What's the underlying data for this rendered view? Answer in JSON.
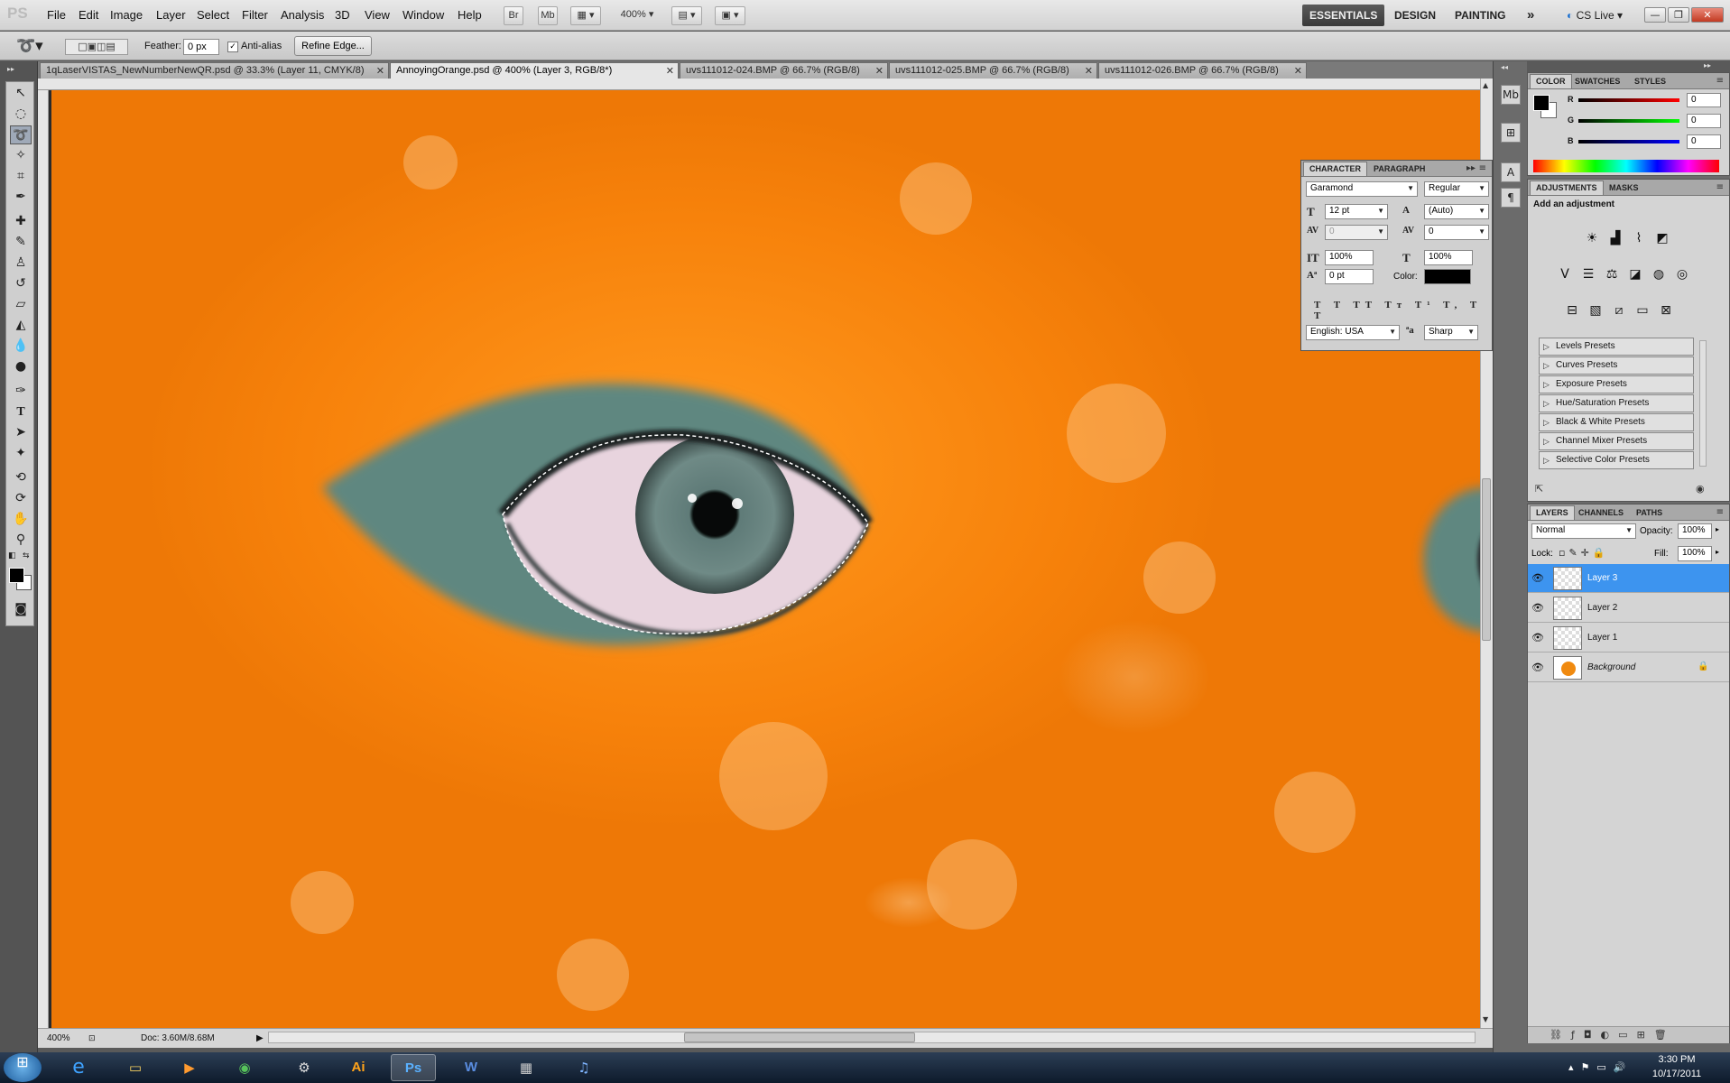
{
  "app": {
    "logo": "PS"
  },
  "menu": [
    "File",
    "Edit",
    "Image",
    "Layer",
    "Select",
    "Filter",
    "Analysis",
    "3D",
    "View",
    "Window",
    "Help"
  ],
  "menubar_buttons": {
    "bridge": "Br",
    "minibridge": "Mb",
    "zoom": "400%"
  },
  "workspaces": {
    "essentials": "ESSENTIALS",
    "design": "DESIGN",
    "painting": "PAINTING",
    "more": "»",
    "cslive": "CS Live"
  },
  "options": {
    "feather_label": "Feather:",
    "feather_value": "0 px",
    "antialias_label": "Anti-alias",
    "antialias_checked": true,
    "refine_edge": "Refine Edge..."
  },
  "tabs": [
    {
      "label": "1qLaserVISTAS_NewNumberNewQR.psd @ 33.3% (Layer 11, CMYK/8)",
      "active": false
    },
    {
      "label": "AnnoyingOrange.psd @ 400% (Layer 3, RGB/8*)",
      "active": true
    },
    {
      "label": "uvs111012-024.BMP @ 66.7% (RGB/8)",
      "active": false
    },
    {
      "label": "uvs111012-025.BMP @ 66.7% (RGB/8)",
      "active": false
    },
    {
      "label": "uvs111012-026.BMP @ 66.7% (RGB/8)",
      "active": false
    }
  ],
  "status": {
    "zoom": "400%",
    "doc": "Doc: 3.60M/8.68M"
  },
  "color_panel": {
    "tabs": [
      "COLOR",
      "SWATCHES",
      "STYLES"
    ],
    "channels": [
      {
        "name": "R",
        "value": "0"
      },
      {
        "name": "G",
        "value": "0"
      },
      {
        "name": "B",
        "value": "0"
      }
    ]
  },
  "character": {
    "tabs": [
      "CHARACTER",
      "PARAGRAPH"
    ],
    "font": "Garamond",
    "style": "Regular",
    "size": "12 pt",
    "leading": "(Auto)",
    "kerning": "0",
    "tracking": "0",
    "vscale": "100%",
    "hscale": "100%",
    "baseline": "0 pt",
    "color_label": "Color:",
    "language": "English: USA",
    "antialias": "Sharp",
    "aa_icon": "ªa"
  },
  "adjustments": {
    "tabs": [
      "ADJUSTMENTS",
      "MASKS"
    ],
    "heading": "Add an adjustment",
    "presets": [
      "Levels Presets",
      "Curves Presets",
      "Exposure Presets",
      "Hue/Saturation Presets",
      "Black & White Presets",
      "Channel Mixer Presets",
      "Selective Color Presets"
    ]
  },
  "layers": {
    "tabs": [
      "LAYERS",
      "CHANNELS",
      "PATHS"
    ],
    "blend": "Normal",
    "opacity_label": "Opacity:",
    "opacity": "100%",
    "lock_label": "Lock:",
    "fill_label": "Fill:",
    "fill": "100%",
    "items": [
      {
        "name": "Layer 3",
        "selected": true
      },
      {
        "name": "Layer 2",
        "selected": false
      },
      {
        "name": "Layer 1",
        "selected": false
      },
      {
        "name": "Background",
        "selected": false
      }
    ]
  },
  "taskbar": {
    "time": "3:30 PM",
    "date": "10/17/2011"
  }
}
